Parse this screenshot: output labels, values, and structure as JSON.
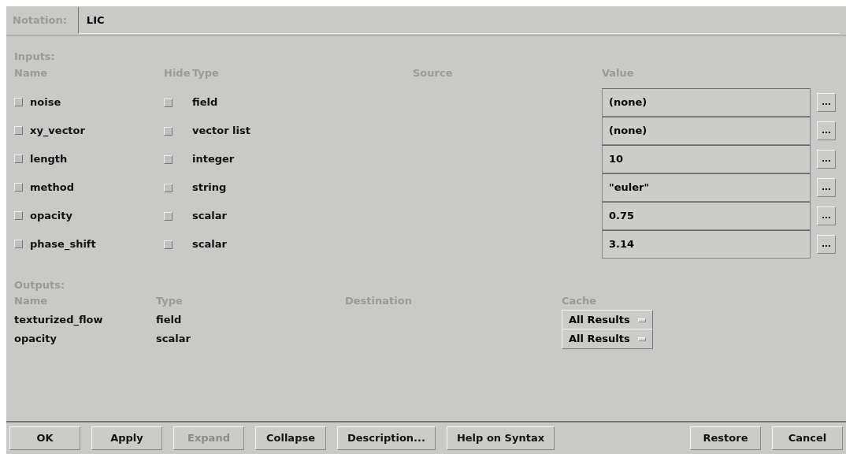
{
  "notation": {
    "label": "Notation:",
    "value": "LIC"
  },
  "inputs": {
    "label": "Inputs:",
    "columns": [
      "Name",
      "Hide",
      "Type",
      "Source",
      "Value"
    ],
    "rows": [
      {
        "name": "noise",
        "checked": false,
        "hide": false,
        "type": "field",
        "value": "(none)",
        "more": "..."
      },
      {
        "name": "xy_vector",
        "checked": false,
        "hide": false,
        "type": "vector list",
        "value": "(none)",
        "more": "..."
      },
      {
        "name": "length",
        "checked": false,
        "hide": false,
        "type": "integer",
        "value": "10",
        "more": "..."
      },
      {
        "name": "method",
        "checked": false,
        "hide": false,
        "type": "string",
        "value": "\"euler\"",
        "more": "..."
      },
      {
        "name": "opacity",
        "checked": false,
        "hide": false,
        "type": "scalar",
        "value": "0.75",
        "more": "..."
      },
      {
        "name": "phase_shift",
        "checked": false,
        "hide": false,
        "type": "scalar",
        "value": "3.14",
        "more": "..."
      }
    ]
  },
  "outputs": {
    "label": "Outputs:",
    "columns": [
      "Name",
      "Type",
      "Destination",
      "Cache"
    ],
    "rows": [
      {
        "name": "texturized_flow",
        "type": "field",
        "cache": "All Results"
      },
      {
        "name": "opacity",
        "type": "scalar",
        "cache": "All Results"
      }
    ]
  },
  "buttons": [
    {
      "label": "OK",
      "disabled": false
    },
    {
      "label": "Apply",
      "disabled": false
    },
    {
      "label": "Expand",
      "disabled": true
    },
    {
      "label": "Collapse",
      "disabled": false
    },
    {
      "label": "Description...",
      "disabled": false
    },
    {
      "label": "Help on Syntax",
      "disabled": false
    },
    {
      "label": "Restore",
      "disabled": false,
      "gap_before": true
    },
    {
      "label": "Cancel",
      "disabled": false
    }
  ]
}
